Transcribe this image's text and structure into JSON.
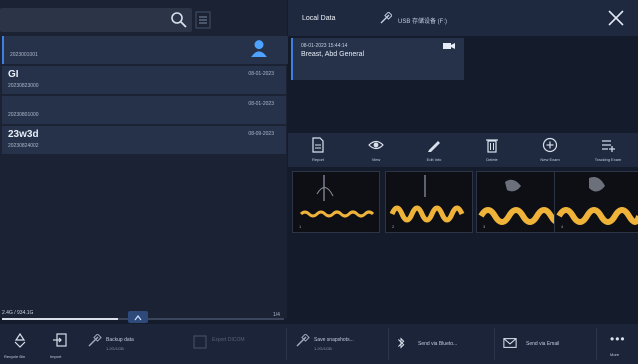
{
  "header": {
    "tab_local": "Local Data",
    "tab_usb": "USB 存储设备 (F:)"
  },
  "patients": [
    {
      "name": "",
      "id": "2023001001",
      "date": ""
    },
    {
      "name": "GI",
      "id": "20230823000",
      "date": "08-01-2023"
    },
    {
      "name": "",
      "id": "20230801000",
      "date": "08-01-2023"
    },
    {
      "name": "23w3d",
      "id": "20230824002",
      "date": "08-09-2023"
    }
  ],
  "storage": {
    "text": "2.4G / 934.1G",
    "count": "1/4"
  },
  "study": {
    "datetime": "08-01-2023 15:44:14",
    "type": "Breast, Abd General"
  },
  "toolbar": [
    {
      "label": "Report",
      "icon": "report-icon"
    },
    {
      "label": "View",
      "icon": "eye-icon"
    },
    {
      "label": "Edit Info",
      "icon": "pencil-icon"
    },
    {
      "label": "Delete",
      "icon": "trash-icon"
    },
    {
      "label": "New Exam",
      "icon": "plus-circle-icon"
    },
    {
      "label": "Tracking Exam",
      "icon": "tracking-icon"
    }
  ],
  "thumbnails": [
    {
      "label": "1"
    },
    {
      "label": "2"
    },
    {
      "label": "3"
    },
    {
      "label": "4"
    }
  ],
  "bottom": {
    "recycle": "Recycle Bin",
    "import": "Import",
    "backup": "Backup data",
    "backup_sub": "1.2G/1GB",
    "disabled": "Export DICOM",
    "disabled_sub": "",
    "save_snapshots": "Save snapshots...",
    "save_sub": "1.2G/1GB",
    "bluetooth": "Send via Blueto...",
    "email": "Send via Email",
    "more": "More"
  }
}
